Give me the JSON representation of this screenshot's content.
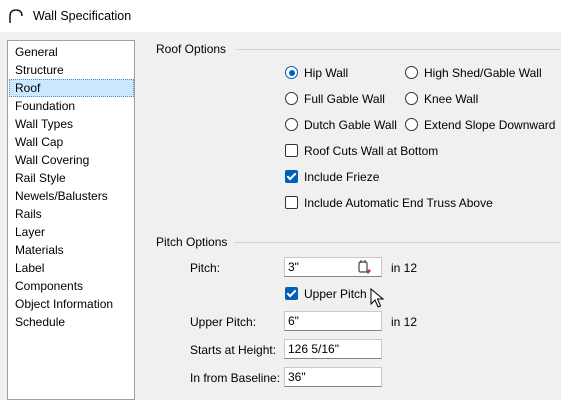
{
  "window": {
    "title": "Wall Specification"
  },
  "sidebar": {
    "items": [
      {
        "label": "General"
      },
      {
        "label": "Structure"
      },
      {
        "label": "Roof"
      },
      {
        "label": "Foundation"
      },
      {
        "label": "Wall Types"
      },
      {
        "label": "Wall Cap"
      },
      {
        "label": "Wall Covering"
      },
      {
        "label": "Rail Style"
      },
      {
        "label": "Newels/Balusters"
      },
      {
        "label": "Rails"
      },
      {
        "label": "Layer"
      },
      {
        "label": "Materials"
      },
      {
        "label": "Label"
      },
      {
        "label": "Components"
      },
      {
        "label": "Object Information"
      },
      {
        "label": "Schedule"
      }
    ],
    "selected": "Roof"
  },
  "roof_options": {
    "group_label": "Roof Options",
    "radios": [
      {
        "label": "Hip Wall",
        "checked": true
      },
      {
        "label": "High Shed/Gable Wall",
        "checked": false
      },
      {
        "label": "Full Gable Wall",
        "checked": false
      },
      {
        "label": "Knee Wall",
        "checked": false
      },
      {
        "label": "Dutch Gable Wall",
        "checked": false
      },
      {
        "label": "Extend Slope Downward",
        "checked": false
      }
    ],
    "checkboxes": [
      {
        "label": "Roof Cuts Wall at Bottom",
        "checked": false
      },
      {
        "label": "Include Frieze",
        "checked": true
      },
      {
        "label": "Include Automatic End Truss Above",
        "checked": false
      }
    ]
  },
  "pitch_options": {
    "group_label": "Pitch Options",
    "pitch_label": "Pitch:",
    "pitch_value": "3\"",
    "pitch_unit": "in 12",
    "upper_pitch_check_label": "Upper Pitch",
    "upper_pitch_checked": true,
    "upper_pitch_label": "Upper Pitch:",
    "upper_pitch_value": "6\"",
    "upper_pitch_unit": "in 12",
    "starts_at_height_label": "Starts at Height:",
    "starts_at_height_value": "126 5/16\"",
    "in_from_baseline_label": "In from Baseline:",
    "in_from_baseline_value": "36\""
  },
  "colors": {
    "accent": "#005fb8",
    "selection": "#cce8ff"
  }
}
